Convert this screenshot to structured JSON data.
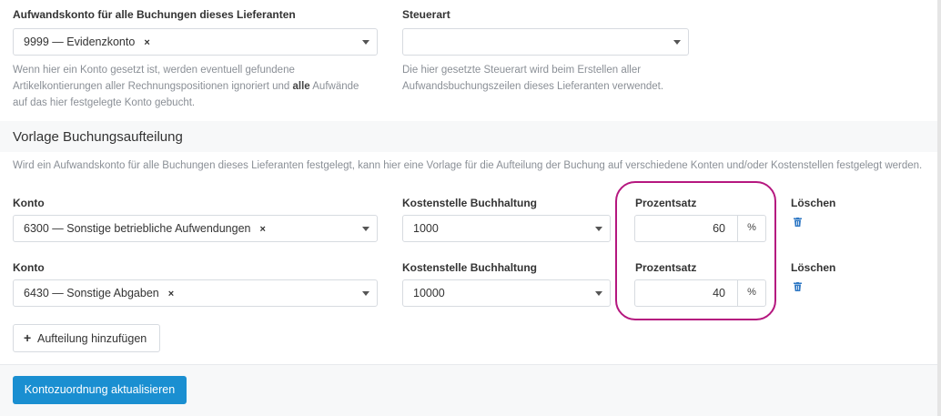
{
  "expense_account": {
    "label": "Aufwandskonto für alle Buchungen dieses Lieferanten",
    "value": "9999 — Evidenzkonto",
    "clear": "×",
    "help_part1": "Wenn hier ein Konto gesetzt ist, werden eventuell gefundene Artikelkontierungen aller Rechnungspositionen ignoriert und ",
    "help_bold": "alle",
    "help_part2": " Aufwände auf das hier festgelegte Konto gebucht."
  },
  "tax_type": {
    "label": "Steuerart",
    "value": "",
    "help": "Die hier gesetzte Steuerart wird beim Erstellen aller Aufwandsbuchungszeilen dieses Lieferanten verwendet."
  },
  "template": {
    "title": "Vorlage Buchungsaufteilung",
    "description": "Wird ein Aufwandskonto für alle Buchungen dieses Lieferanten festgelegt, kann hier eine Vorlage für die Aufteilung der Buchung auf verschiedene Konten und/oder Kostenstellen festgelegt werden.",
    "rows": [
      {
        "account_label": "Konto",
        "account_value": "6300 — Sonstige betriebliche Aufwendungen",
        "clear": "×",
        "cost_center_label": "Kostenstelle Buchhaltung",
        "cost_center_value": "1000",
        "percent_label": "Prozentsatz",
        "percent_value": "60",
        "percent_unit": "%",
        "delete_label": "Löschen",
        "delete_icon": "trash-icon"
      },
      {
        "account_label": "Konto",
        "account_value": "6430 — Sonstige Abgaben",
        "clear": "×",
        "cost_center_label": "Kostenstelle Buchhaltung",
        "cost_center_value": "10000",
        "percent_label": "Prozentsatz",
        "percent_value": "40",
        "percent_unit": "%",
        "delete_label": "Löschen",
        "delete_icon": "trash-icon"
      }
    ],
    "add_button_plus": "+",
    "add_button": "Aufteilung hinzufügen"
  },
  "footer": {
    "submit": "Kontozuordnung aktualisieren"
  },
  "colors": {
    "primary": "#1a8fd1",
    "highlight": "#b5177f",
    "trash": "#2f78c4"
  }
}
